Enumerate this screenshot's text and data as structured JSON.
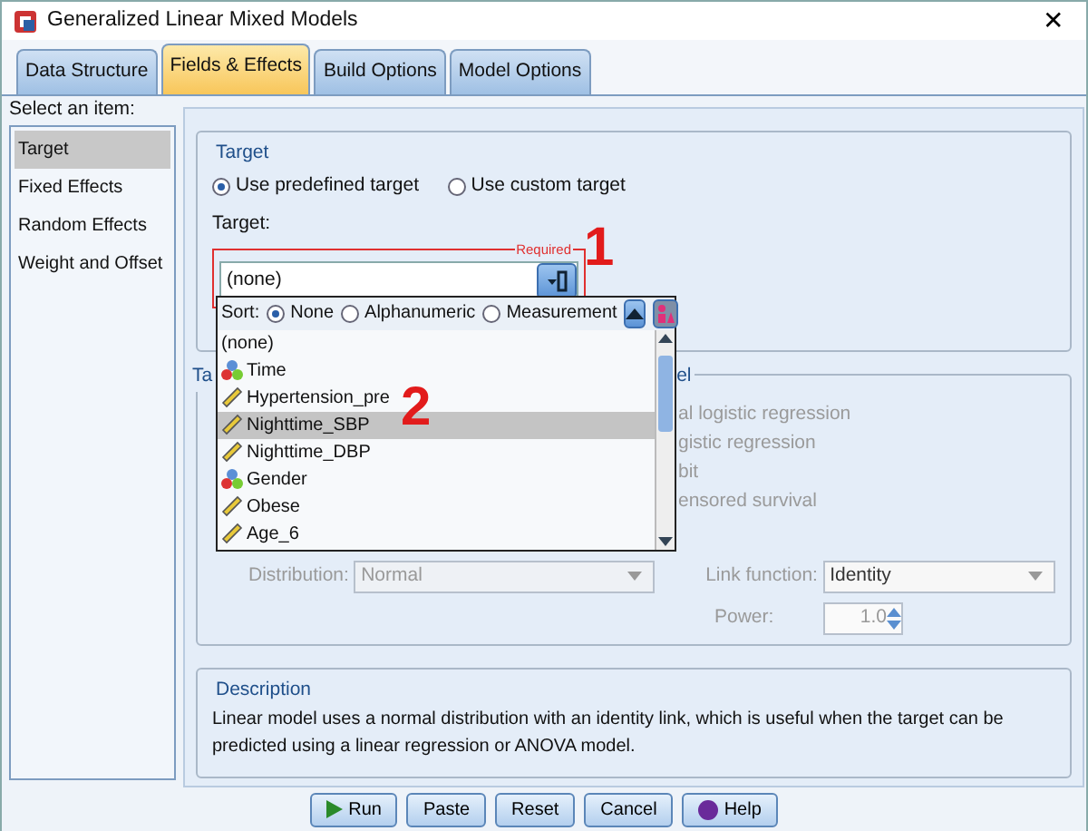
{
  "window": {
    "title": "Generalized Linear Mixed Models",
    "close": "✕"
  },
  "tabs": [
    {
      "label": "Data Structure",
      "selected": false
    },
    {
      "label": "Fields & Effects",
      "selected": true
    },
    {
      "label": "Build Options",
      "selected": false
    },
    {
      "label": "Model Options",
      "selected": false
    }
  ],
  "sidebar": {
    "label": "Select an item:",
    "items": [
      {
        "label": "Target",
        "selected": true
      },
      {
        "label": "Fixed Effects",
        "selected": false
      },
      {
        "label": "Random Effects",
        "selected": false
      },
      {
        "label": "Weight and Offset",
        "selected": false
      }
    ]
  },
  "target_section": {
    "title": "Target",
    "options": [
      {
        "label": "Use predefined target",
        "selected": true
      },
      {
        "label": "Use custom target",
        "selected": false
      }
    ],
    "field_label": "Target:",
    "required_label": "Required",
    "value": "(none)"
  },
  "target_list": {
    "sort_label": "Sort:",
    "sort_options": [
      {
        "label": "None",
        "selected": true
      },
      {
        "label": "Alphanumeric",
        "selected": false
      },
      {
        "label": "Measurement",
        "selected": false
      }
    ],
    "items": [
      {
        "name": "(none)",
        "kind": "none",
        "selected": false
      },
      {
        "name": "Time",
        "kind": "nominal",
        "selected": false
      },
      {
        "name": "Hypertension_pre",
        "kind": "scale",
        "selected": false
      },
      {
        "name": "Nighttime_SBP",
        "kind": "scale",
        "selected": true
      },
      {
        "name": "Nighttime_DBP",
        "kind": "scale",
        "selected": false
      },
      {
        "name": "Gender",
        "kind": "nominal",
        "selected": false
      },
      {
        "name": "Obese",
        "kind": "scale",
        "selected": false
      },
      {
        "name": "Age_6",
        "kind": "scale",
        "selected": false
      }
    ]
  },
  "model_section": {
    "title_start": "Ta",
    "title_end": "el",
    "options": [
      "al logistic regression",
      "gistic regression",
      "bit",
      "ensored survival"
    ],
    "distribution_label": "Distribution:",
    "distribution": "Normal",
    "link_label": "Link function:",
    "link": "Identity",
    "power_label": "Power:",
    "power": "1.0",
    "disabled": true
  },
  "description": {
    "title": "Description",
    "text": "Linear model uses a normal distribution with an identity link, which is useful when the target can be predicted using a linear regression or ANOVA model."
  },
  "buttons": [
    {
      "label": "Run",
      "kind": "run"
    },
    {
      "label": "Paste",
      "kind": "plain"
    },
    {
      "label": "Reset",
      "kind": "plain"
    },
    {
      "label": "Cancel",
      "kind": "plain"
    },
    {
      "label": "Help",
      "kind": "help"
    }
  ],
  "annotations": [
    "1",
    "2"
  ]
}
